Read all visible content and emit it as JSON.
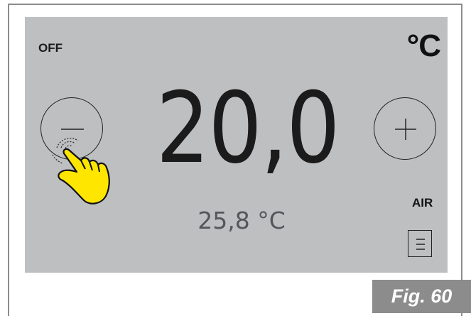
{
  "thermostat": {
    "mode_label": "OFF",
    "unit_label": "°C",
    "setpoint": "20,0",
    "current_temp": "25,8 °C",
    "fan_label": "AIR",
    "decrease_icon": "minus-icon",
    "increase_icon": "plus-icon",
    "menu_icon": "menu-icon"
  },
  "figure": {
    "caption": "Fig. 60"
  },
  "colors": {
    "screen_bg": "#bebfc1",
    "caption_bg": "#8c8c8c",
    "hand_fill": "#ffe600"
  }
}
